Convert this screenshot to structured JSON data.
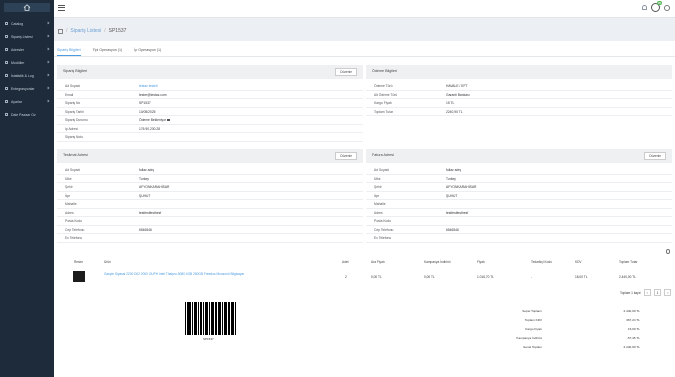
{
  "sidebar": {
    "items": [
      {
        "label": "Catalog"
      },
      {
        "label": "Sipariş Listesi"
      },
      {
        "label": "Adresler"
      },
      {
        "label": "Modüller"
      },
      {
        "label": "İstatistik & Log"
      },
      {
        "label": "Entegrasyonlar"
      },
      {
        "label": "Ayarlar"
      },
      {
        "label": "Dale Pazaar Oz"
      }
    ]
  },
  "topbar": {
    "badge": "35"
  },
  "breadcrumb": {
    "link": "Sipariş Listesi",
    "current": "SP1537"
  },
  "tabs": [
    {
      "label": "Sipariş Bilgileri"
    },
    {
      "label": "Tipi Operasyon (1)"
    },
    {
      "label": "İp Operasyon (1)"
    }
  ],
  "order_info": {
    "title": "Sipariş Bilgileri",
    "button": "Düzenle",
    "rows": [
      {
        "key": "Ad Soyadı",
        "value": "testaz testetl"
      },
      {
        "key": "Email",
        "value": "tester@testaz.com"
      },
      {
        "key": "Sipariş No",
        "value": "SP1537"
      },
      {
        "key": "Sipariş Tarihi",
        "value": "10/05/2025"
      },
      {
        "key": "Sipariş Durumu",
        "value": "Ödeme Bekleniyor"
      },
      {
        "key": "Ip Adresi",
        "value": "176.90.230.28"
      },
      {
        "key": "Sipariş Notu",
        "value": ""
      }
    ]
  },
  "payment_info": {
    "title": "Ödeme Bilgileri",
    "rows": [
      {
        "key": "Ödeme Türü",
        "value": "HAVALE / EFT"
      },
      {
        "key": "Alt Ödeme Türü",
        "value": "Garanti Bankası"
      },
      {
        "key": "Kargo Fiyatı",
        "value": "15 TL"
      },
      {
        "key": "Toplam Tutar",
        "value": "2240,90 TL"
      }
    ]
  },
  "shipping_address": {
    "title": "Teslimat Adresi",
    "button": "Düzenle",
    "rows": [
      {
        "key": "Ad Soyadı",
        "value": "fullaz adrş"
      },
      {
        "key": "Ülke",
        "value": "Turkey"
      },
      {
        "key": "Şehir",
        "value": "AFYONKARAHİSAR"
      },
      {
        "key": "İlçe",
        "value": "ŞUHUT"
      },
      {
        "key": "Mahalle",
        "value": ""
      },
      {
        "key": "Adres",
        "value": "testfestfesthesf"
      },
      {
        "key": "Posta Kodu",
        "value": ""
      },
      {
        "key": "Cep Telefonu",
        "value": "6546546"
      },
      {
        "key": "Ev Telefonu",
        "value": ""
      }
    ]
  },
  "billing_address": {
    "title": "Fatura Adresi",
    "button": "Düzenle",
    "rows": [
      {
        "key": "Ad Soyadı",
        "value": "fullaz adrş"
      },
      {
        "key": "Ülke",
        "value": "Turkey"
      },
      {
        "key": "Şehir",
        "value": "AFYONKARAHİSAR"
      },
      {
        "key": "İlçe",
        "value": "ŞUHUT"
      },
      {
        "key": "Mahalle",
        "value": ""
      },
      {
        "key": "Adres",
        "value": "testfestfesthesf"
      },
      {
        "key": "Posta Kodu",
        "value": ""
      },
      {
        "key": "Cep Telefonu",
        "value": "6546546"
      },
      {
        "key": "Ev Telefonu",
        "value": ""
      }
    ]
  },
  "products": {
    "headers": [
      "Resim",
      "Ürün",
      "Adet",
      "Ara Fiyatı",
      "Kampanya İndirimi",
      "Fiyatı",
      "Tedarikçi Kodu",
      "KDV",
      "Toplam Tutar"
    ],
    "rows": [
      {
        "name": "Gaspin Siyasal 2200 D02 2000 OUPH Intel Thatpro-5080 4GB 250GB Freedos Mousonü Bilgisayar",
        "qty": "2",
        "unit_price": "0,00 TL",
        "discount": "0,00 TL",
        "price": "1.016,70 TL",
        "supplier": "-",
        "vat": "18,00 TL",
        "total": "2.440,00 TL"
      }
    ],
    "pager_label": "Toplam 1 kayıt",
    "page": "1"
  },
  "barcode_text": "SP1537",
  "totals": [
    {
      "label": "Sepet Toplamı",
      "value": "2.440,00 TL"
    },
    {
      "label": "Toplam KDV",
      "value": "367,24 TL"
    },
    {
      "label": "Kargo Fiyatı",
      "value": "15,00 TL"
    },
    {
      "label": "Kampanya İndirimi",
      "value": "-57,45 TL"
    },
    {
      "label": "Genel Toplam",
      "value": "2.240,90 TL"
    }
  ]
}
